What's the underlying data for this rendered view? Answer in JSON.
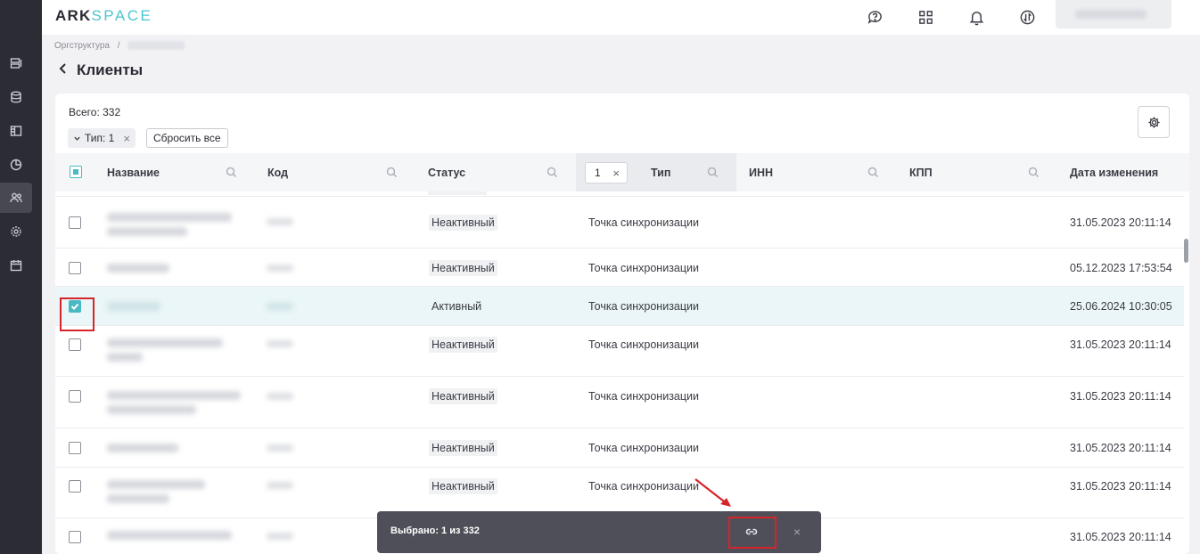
{
  "brand": {
    "part1": "ARK",
    "part2": "SPACE"
  },
  "breadcrumb": {
    "root": "Оргструктура",
    "sep": "/"
  },
  "page": {
    "title": "Клиенты"
  },
  "summary": {
    "total": "Всего: 332"
  },
  "filters": {
    "chip_label": "Тип: 1",
    "chip_remove": "×",
    "reset_label": "Сбросить все"
  },
  "table": {
    "columns": {
      "name": "Название",
      "code": "Код",
      "status": "Статус",
      "type_filter_count": "1",
      "type_filter_clear": "×",
      "type": "Тип",
      "inn": "ИНН",
      "kpp": "КПП",
      "modified": "Дата изменения"
    },
    "rows": [
      {
        "status": "Неактивный",
        "type": "Точка синхронизации",
        "modified": "31.05.2023 20:11:14",
        "checked": false
      },
      {
        "status": "Неактивный",
        "type": "Точка синхронизации",
        "modified": "05.12.2023 17:53:54",
        "checked": false
      },
      {
        "status": "Активный",
        "type": "Точка синхронизации",
        "modified": "25.06.2024 10:30:05",
        "checked": true
      },
      {
        "status": "Неактивный",
        "type": "Точка синхронизации",
        "modified": "31.05.2023 20:11:14",
        "checked": false
      },
      {
        "status": "Неактивный",
        "type": "Точка синхронизации",
        "modified": "31.05.2023 20:11:14",
        "checked": false
      },
      {
        "status": "Неактивный",
        "type": "Точка синхронизации",
        "modified": "31.05.2023 20:11:14",
        "checked": false
      },
      {
        "status": "Неактивный",
        "type": "Точка синхронизации",
        "modified": "31.05.2023 20:11:14",
        "checked": false
      },
      {
        "status": "",
        "type": "",
        "modified": "31.05.2023 20:11:14",
        "checked": false
      }
    ]
  },
  "selection_bar": {
    "text": "Выбрано: 1 из 332",
    "close": "×"
  },
  "colors": {
    "accent": "#49b9c4",
    "sidebar": "#2b2c34",
    "highlight": "#d6242a"
  }
}
